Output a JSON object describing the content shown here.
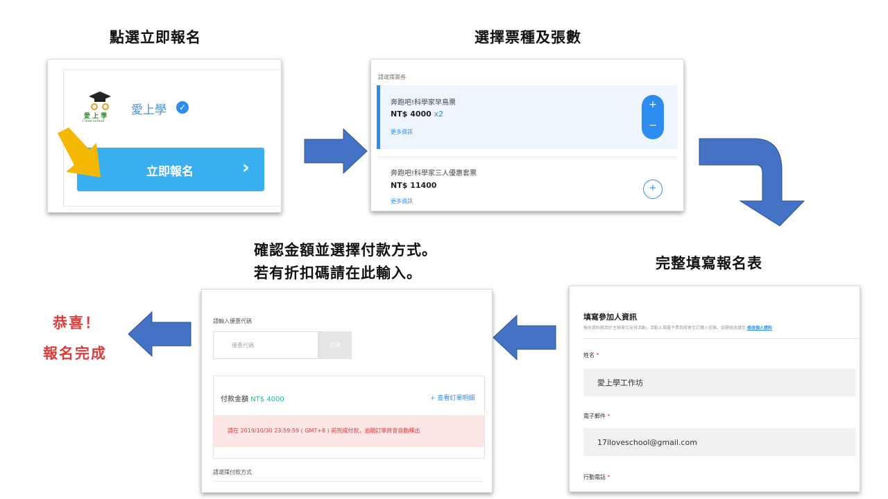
{
  "steps": {
    "step1": {
      "heading": "點選立即報名",
      "brand_name": "愛上學",
      "logo_text": "愛 上 學",
      "logo_subtext": "I love school",
      "register_label": "立即報名"
    },
    "step2": {
      "heading": "選擇票種及張數",
      "section_label": "請選擇票券",
      "tickets": [
        {
          "name": "奔跑吧!科學家早鳥票",
          "price": "NT$ 4000",
          "qty": "x2",
          "more": "更多資訊"
        },
        {
          "name": "奔跑吧!科學家三人優惠套票",
          "price": "NT$ 11400",
          "more": "更多資訊"
        }
      ],
      "plus": "+",
      "minus": "−"
    },
    "step3": {
      "heading": "完整填寫報名表",
      "title": "填寫參加人資訊",
      "notice": "報名資料將用於主辦單位安排活動，活動入場電子票券將寄至訂購人信箱，如需修改請至",
      "notice_link": "修改個人資料",
      "fields": [
        {
          "label": "姓名",
          "value": "愛上學工作坊"
        },
        {
          "label": "電子郵件",
          "value": "17iloveschool@gmail.com"
        },
        {
          "label": "行動電話"
        }
      ],
      "required_mark": "*"
    },
    "step4": {
      "heading_line1": "確認金額並選擇付款方式。",
      "heading_line2": "若有折扣碼請在此輸入。",
      "coupon_label": "請輸入優惠代碼",
      "coupon_placeholder": "優惠代碼",
      "coupon_button": "兌換",
      "amount_label": "付款金額",
      "amount_value": "NT$ 4000",
      "view_order": "+ 查看訂單明細",
      "deadline_prefix": "請在",
      "deadline_datetime": "2019/10/30 23:59:59 ( GMT+8 )",
      "deadline_suffix": "前完成付款，逾期訂單將會自動釋出",
      "payment_label": "請選擇付款方式"
    },
    "done": {
      "line1": "恭喜！",
      "line2": "報名完成"
    }
  },
  "colors": {
    "arrow": "#4472c4",
    "primary_button": "#3ab0f0",
    "accent": "#2d8cf0",
    "pointer": "#f5b800",
    "done_text": "#e03a3a",
    "deadline_bg": "#fde6e6"
  }
}
